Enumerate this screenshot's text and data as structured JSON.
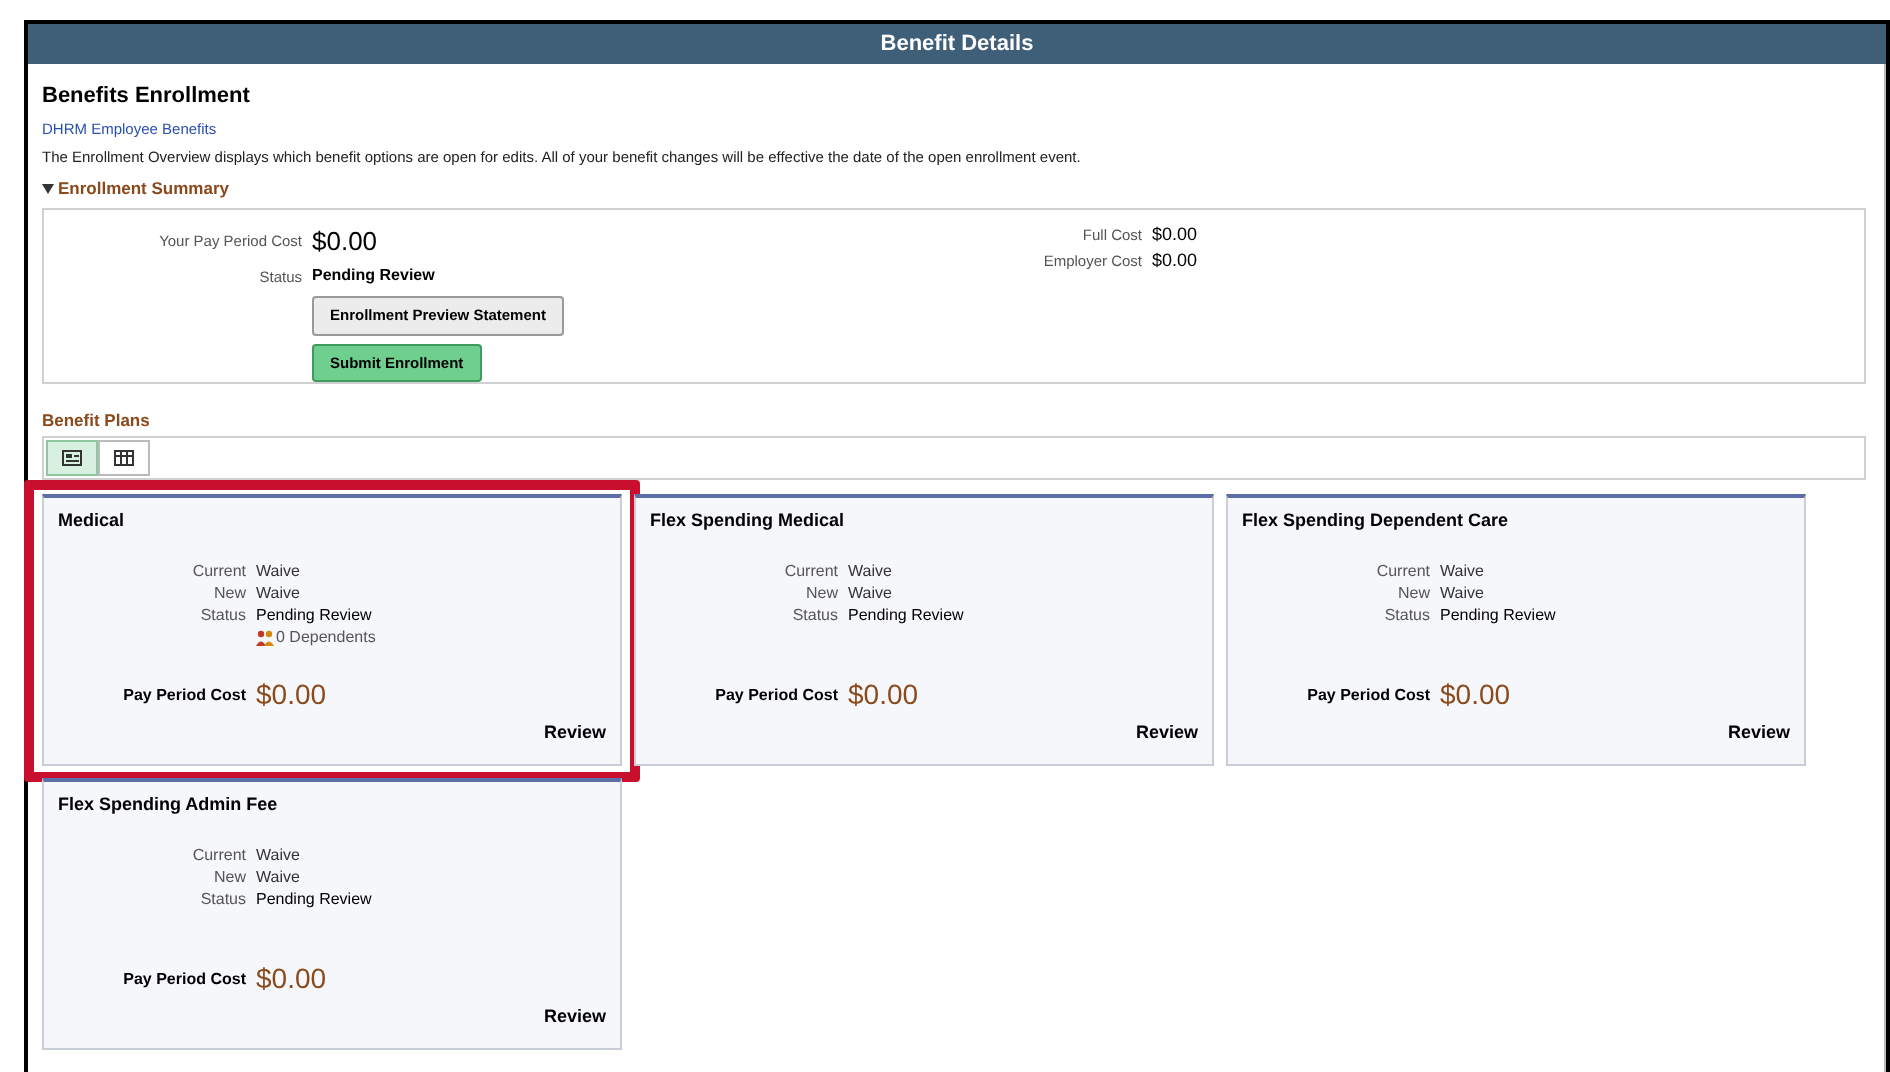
{
  "window": {
    "title": "Benefit Details"
  },
  "page_title": "Benefits Enrollment",
  "link": "DHRM Employee Benefits",
  "description": "The Enrollment Overview displays which benefit options are open for edits. All of your benefit changes will be effective the date of the open enrollment event.",
  "summary": {
    "title": "Enrollment Summary",
    "expanded": true,
    "left": [
      {
        "label": "Your Pay Period Cost",
        "value": "$0.00",
        "kind": "amount"
      },
      {
        "label": "Status",
        "value": "Pending Review",
        "kind": "status"
      }
    ],
    "right": [
      {
        "label": "Full Cost",
        "value": "$0.00"
      },
      {
        "label": "Employer Cost",
        "value": "$0.00"
      }
    ],
    "buttons": [
      {
        "label": "Enrollment Preview Statement",
        "kind": "default"
      },
      {
        "label": "Submit Enrollment",
        "kind": "primary"
      }
    ]
  },
  "plans": {
    "title": "Benefit Plans",
    "views": [
      {
        "kind": "cards",
        "selected": true
      },
      {
        "kind": "grid",
        "selected": false
      }
    ],
    "cards": [
      {
        "title": "Medical",
        "highlighted": true,
        "fields": [
          {
            "label": "Current",
            "value": "Waive"
          },
          {
            "label": "New",
            "value": "Waive"
          },
          {
            "label": "Status",
            "value": "Pending Review"
          }
        ],
        "dependents": "0 Dependents",
        "cost_label": "Pay Period Cost",
        "cost": "$0.00",
        "action": "Review"
      },
      {
        "title": "Flex Spending Medical",
        "highlighted": false,
        "fields": [
          {
            "label": "Current",
            "value": "Waive"
          },
          {
            "label": "New",
            "value": "Waive"
          },
          {
            "label": "Status",
            "value": "Pending Review"
          }
        ],
        "cost_label": "Pay Period Cost",
        "cost": "$0.00",
        "action": "Review"
      },
      {
        "title": "Flex Spending Dependent Care",
        "highlighted": false,
        "fields": [
          {
            "label": "Current",
            "value": "Waive"
          },
          {
            "label": "New",
            "value": "Waive"
          },
          {
            "label": "Status",
            "value": "Pending Review"
          }
        ],
        "cost_label": "Pay Period Cost",
        "cost": "$0.00",
        "action": "Review"
      },
      {
        "title": "Flex Spending Admin Fee",
        "highlighted": false,
        "fields": [
          {
            "label": "Current",
            "value": "Waive"
          },
          {
            "label": "New",
            "value": "Waive"
          },
          {
            "label": "Status",
            "value": "Pending Review"
          }
        ],
        "cost_label": "Pay Period Cost",
        "cost": "$0.00",
        "action": "Review"
      }
    ]
  }
}
